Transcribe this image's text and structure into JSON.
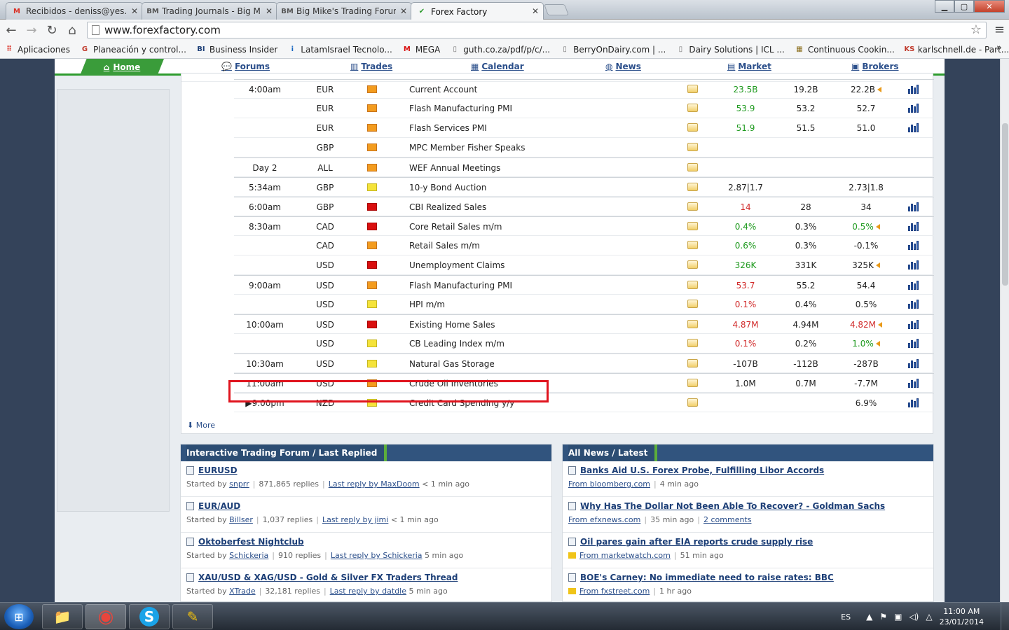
{
  "browser": {
    "tabs": [
      {
        "title": "Recibidos - deniss@yes.cc",
        "icon": "gmail-icon",
        "glyph": "M",
        "color": "#d93025"
      },
      {
        "title": "Trading Journals - Big Mik",
        "icon": "bmt-icon",
        "glyph": "BM",
        "color": "#555555"
      },
      {
        "title": "Big Mike's Trading Forum",
        "icon": "bmt-icon",
        "glyph": "BM",
        "color": "#555555"
      },
      {
        "title": "Forex Factory",
        "icon": "forexfactory-icon",
        "glyph": "✔",
        "color": "#2d9b2d"
      }
    ],
    "url": "www.forexfactory.com",
    "bookmarks": [
      {
        "label": "Aplicaciones",
        "glyph": "⠿",
        "color": "#d93025"
      },
      {
        "label": "Planeación y control...",
        "glyph": "G",
        "color": "#c0392b"
      },
      {
        "label": "Business Insider",
        "glyph": "BI",
        "color": "#1d3f77"
      },
      {
        "label": "LatamIsrael Tecnolo...",
        "glyph": "i",
        "color": "#1565c0"
      },
      {
        "label": "MEGA",
        "glyph": "M",
        "color": "#d90f0f"
      },
      {
        "label": "guth.co.za/pdf/p/c/...",
        "glyph": "▯",
        "color": "#777777"
      },
      {
        "label": "BerryOnDairy.com | ...",
        "glyph": "▯",
        "color": "#777777"
      },
      {
        "label": "Dairy Solutions | ICL ...",
        "glyph": "▯",
        "color": "#777777"
      },
      {
        "label": "Continuous Cookin...",
        "glyph": "▦",
        "color": "#8a6d1a"
      },
      {
        "label": "karlschnell.de - Part...",
        "glyph": "KS",
        "color": "#c0392b"
      }
    ],
    "bookmarks_more": "»"
  },
  "site_nav": {
    "home": "Home",
    "items": [
      {
        "label": "Forums",
        "icon": "forums-icon",
        "glyph": "💬"
      },
      {
        "label": "Trades",
        "icon": "trades-icon",
        "glyph": "▥"
      },
      {
        "label": "Calendar",
        "icon": "calendar-icon",
        "glyph": "▦"
      },
      {
        "label": "News",
        "icon": "news-icon",
        "glyph": "◍"
      },
      {
        "label": "Market",
        "icon": "market-icon",
        "glyph": "▤"
      },
      {
        "label": "Brokers",
        "icon": "brokers-icon",
        "glyph": "▣"
      }
    ]
  },
  "calendar": {
    "rows": [
      {
        "time": "4:00am",
        "currency": "EUR",
        "impact": "orange",
        "event": "Current Account",
        "actual": "23.5B",
        "actual_class": "good",
        "forecast": "19.2B",
        "previous": "22.2B",
        "revised": true,
        "graph": true,
        "sep": true
      },
      {
        "time": "",
        "currency": "EUR",
        "impact": "orange",
        "event": "Flash Manufacturing PMI",
        "actual": "53.9",
        "actual_class": "good",
        "forecast": "53.2",
        "previous": "52.7",
        "revised": false,
        "graph": true,
        "sep": false
      },
      {
        "time": "",
        "currency": "EUR",
        "impact": "orange",
        "event": "Flash Services PMI",
        "actual": "51.9",
        "actual_class": "good",
        "forecast": "51.5",
        "previous": "51.0",
        "revised": false,
        "graph": true,
        "sep": false
      },
      {
        "time": "",
        "currency": "GBP",
        "impact": "orange",
        "event": "MPC Member Fisher Speaks",
        "actual": "",
        "actual_class": "",
        "forecast": "",
        "previous": "",
        "revised": false,
        "graph": false,
        "sep": false
      },
      {
        "time": "Day 2",
        "currency": "ALL",
        "impact": "orange",
        "event": "WEF Annual Meetings",
        "actual": "",
        "actual_class": "",
        "forecast": "",
        "previous": "",
        "revised": false,
        "graph": false,
        "sep": true
      },
      {
        "time": "5:34am",
        "currency": "GBP",
        "impact": "yellow",
        "event": "10-y Bond Auction",
        "actual": "2.87|1.7",
        "actual_class": "",
        "forecast": "",
        "previous": "2.73|1.8",
        "revised": false,
        "graph": false,
        "sep": true
      },
      {
        "time": "6:00am",
        "currency": "GBP",
        "impact": "red",
        "event": "CBI Realized Sales",
        "actual": "14",
        "actual_class": "bad",
        "forecast": "28",
        "previous": "34",
        "revised": false,
        "graph": true,
        "sep": true
      },
      {
        "time": "8:30am",
        "currency": "CAD",
        "impact": "red",
        "event": "Core Retail Sales m/m",
        "actual": "0.4%",
        "actual_class": "good",
        "forecast": "0.3%",
        "previous": "0.5%",
        "previous_class": "good",
        "revised": true,
        "graph": true,
        "sep": true
      },
      {
        "time": "",
        "currency": "CAD",
        "impact": "orange",
        "event": "Retail Sales m/m",
        "actual": "0.6%",
        "actual_class": "good",
        "forecast": "0.3%",
        "previous": "-0.1%",
        "revised": false,
        "graph": true,
        "sep": false
      },
      {
        "time": "",
        "currency": "USD",
        "impact": "red",
        "event": "Unemployment Claims",
        "actual": "326K",
        "actual_class": "good",
        "forecast": "331K",
        "previous": "325K",
        "revised": true,
        "graph": true,
        "sep": false
      },
      {
        "time": "9:00am",
        "currency": "USD",
        "impact": "orange",
        "event": "Flash Manufacturing PMI",
        "actual": "53.7",
        "actual_class": "bad",
        "forecast": "55.2",
        "previous": "54.4",
        "revised": false,
        "graph": true,
        "sep": true
      },
      {
        "time": "",
        "currency": "USD",
        "impact": "yellow",
        "event": "HPI m/m",
        "actual": "0.1%",
        "actual_class": "bad",
        "forecast": "0.4%",
        "previous": "0.5%",
        "revised": false,
        "graph": true,
        "sep": false
      },
      {
        "time": "10:00am",
        "currency": "USD",
        "impact": "red",
        "event": "Existing Home Sales",
        "actual": "4.87M",
        "actual_class": "bad",
        "forecast": "4.94M",
        "previous": "4.82M",
        "previous_class": "bad",
        "revised": true,
        "graph": true,
        "sep": true
      },
      {
        "time": "",
        "currency": "USD",
        "impact": "yellow",
        "event": "CB Leading Index m/m",
        "actual": "0.1%",
        "actual_class": "bad",
        "forecast": "0.2%",
        "previous": "1.0%",
        "previous_class": "good",
        "revised": true,
        "graph": true,
        "sep": false
      },
      {
        "time": "10:30am",
        "currency": "USD",
        "impact": "yellow",
        "event": "Natural Gas Storage",
        "actual": "-107B",
        "actual_class": "",
        "forecast": "-112B",
        "previous": "-287B",
        "revised": false,
        "graph": true,
        "sep": true
      },
      {
        "time": "11:00am",
        "currency": "USD",
        "impact": "orange",
        "event": "Crude Oil Inventories",
        "actual": "1.0M",
        "actual_class": "",
        "forecast": "0.7M",
        "previous": "-7.7M",
        "revised": false,
        "graph": true,
        "sep": true
      },
      {
        "time": "▶9:00pm",
        "currency": "NZD",
        "impact": "yellow",
        "event": "Credit Card Spending y/y",
        "actual": "",
        "actual_class": "",
        "forecast": "",
        "previous": "6.9%",
        "revised": false,
        "graph": true,
        "sep": true
      }
    ],
    "more_label": "More"
  },
  "forum_panel": {
    "title": "Interactive Trading Forum / Last Replied",
    "items": [
      {
        "title": "EURUSD",
        "started_by_label": "Started by",
        "author": "snprr",
        "replies": "871,865 replies",
        "last_reply": "Last reply by MaxDoom",
        "age": "< 1 min ago"
      },
      {
        "title": "EUR/AUD",
        "started_by_label": "Started by",
        "author": "Billser",
        "replies": "1,037 replies",
        "last_reply": "Last reply by jimi",
        "age": "< 1 min ago"
      },
      {
        "title": "Oktoberfest Nightclub",
        "started_by_label": "Started by",
        "author": "Schickeria",
        "replies": "910 replies",
        "last_reply": "Last reply by Schickeria",
        "age": "5 min ago"
      },
      {
        "title": "XAU/USD & XAG/USD - Gold & Silver FX Traders Thread",
        "started_by_label": "Started by",
        "author": "XTrade",
        "replies": "32,181 replies",
        "last_reply": "Last reply by datdle",
        "age": "5 min ago"
      }
    ]
  },
  "news_panel": {
    "title": "All News / Latest",
    "items": [
      {
        "title": "Banks Aid U.S. Forex Probe, Fulfilling Libor Accords",
        "source": "From bloomberg.com",
        "age": "4 min ago",
        "comments": "",
        "folder": false
      },
      {
        "title": "Why Has The Dollar Not Been Able To Recover? - Goldman Sachs",
        "source": "From efxnews.com",
        "age": "35 min ago",
        "comments": "2 comments",
        "folder": false
      },
      {
        "title": "Oil pares gain after EIA reports crude supply rise",
        "source": "From marketwatch.com",
        "age": "51 min ago",
        "comments": "",
        "folder": true
      },
      {
        "title": "BOE's Carney: No immediate need to raise rates: BBC",
        "source": "From fxstreet.com",
        "age": "1 hr ago",
        "comments": "",
        "folder": true
      }
    ]
  },
  "taskbar": {
    "lang": "ES",
    "time": "11:00 AM",
    "date": "23/01/2014",
    "apps": [
      {
        "name": "explorer-app",
        "glyph": "📁",
        "active": false
      },
      {
        "name": "chrome-app",
        "glyph": "◉",
        "active": true
      },
      {
        "name": "skype-app",
        "glyph": "S",
        "active": false
      },
      {
        "name": "notes-app",
        "glyph": "✎",
        "active": false
      }
    ]
  }
}
